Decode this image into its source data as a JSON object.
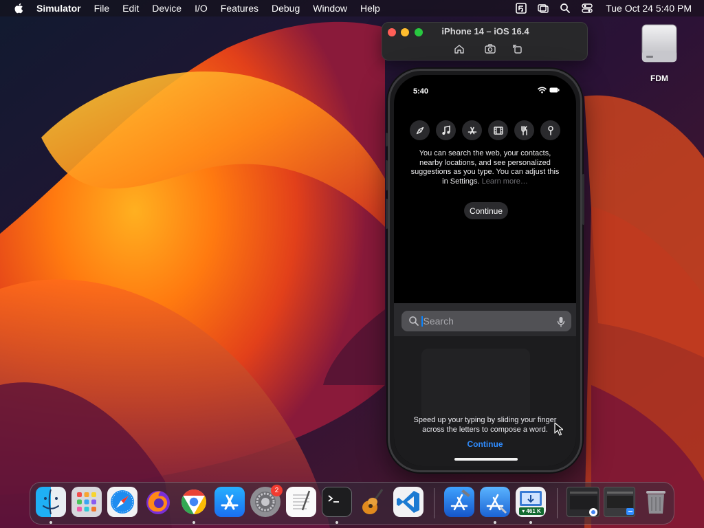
{
  "menubar": {
    "app_name": "Simulator",
    "menus": [
      "File",
      "Edit",
      "Device",
      "I/O",
      "Features",
      "Debug",
      "Window",
      "Help"
    ],
    "clock": "Tue Oct 24  5:40 PM",
    "status_icons": [
      "fdm-icon",
      "screen-mirroring-icon",
      "spotlight-search-icon",
      "control-center-icon"
    ]
  },
  "desktop": {
    "drive_label": "FDM"
  },
  "simulator": {
    "window_title": "iPhone 14 – iOS 16.4",
    "toolbar": [
      "home-icon",
      "screenshot-icon",
      "rotate-icon"
    ]
  },
  "phone": {
    "status_time": "5:40",
    "intro_text": "You can search the web, your contacts, nearby locations, and see personalized suggestions as you type. You can adjust this in Settings.",
    "learn_more": "Learn more…",
    "continue_label": "Continue",
    "search_placeholder": "Search",
    "swipe_text": "Speed up your typing by sliding your finger across the letters to compose a word.",
    "swipe_continue_label": "Continue",
    "app_icons": [
      "safari-icon",
      "music-icon",
      "app-store-icon",
      "film-icon",
      "food-icon",
      "maps-pin-icon"
    ]
  },
  "dock": {
    "apps": [
      "finder-icon",
      "launchpad-icon",
      "safari-icon",
      "firefox-icon",
      "chrome-icon",
      "app-store-icon",
      "system-settings-icon",
      "textedit-icon",
      "terminal-icon",
      "garageband-icon",
      "vscode-icon",
      "xcode-icon",
      "xcode-instruments-icon",
      "fdm-download-icon",
      "chrome-window-icon",
      "finder-window-icon",
      "trash-icon"
    ],
    "settings_badge": "2",
    "fdm_speed": "▾ 461 K"
  },
  "colors": {
    "accent_blue": "#0a84ff",
    "link_blue": "#2f8cff",
    "badge_red": "#f23b30"
  }
}
